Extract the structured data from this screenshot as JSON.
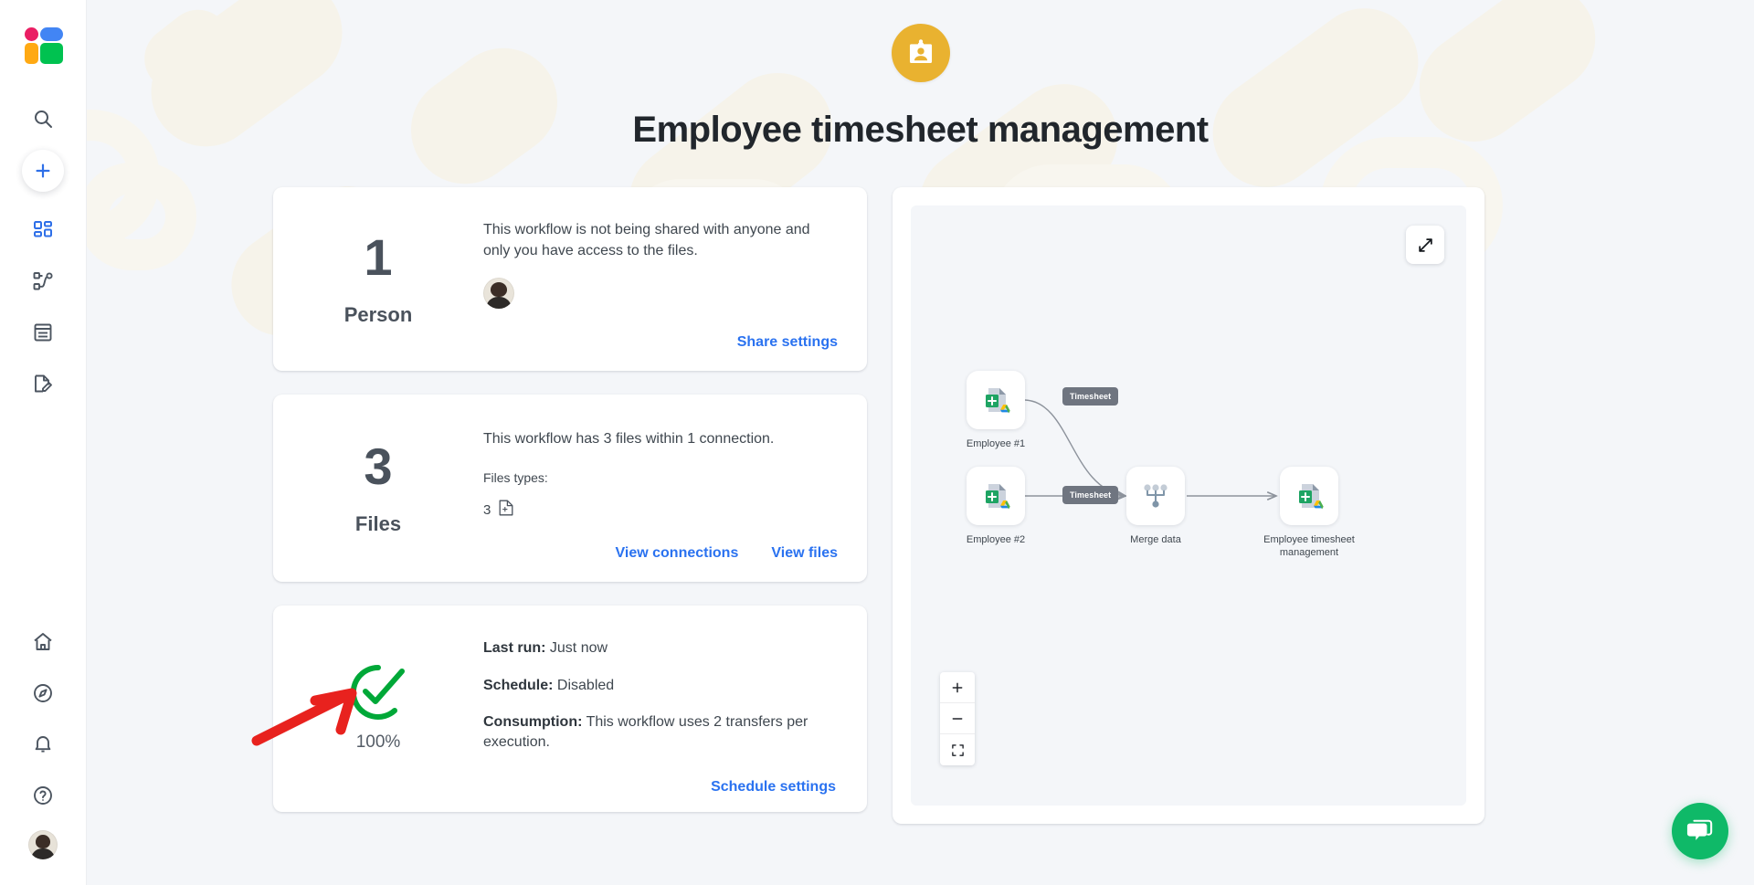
{
  "sidebar": {
    "logo_name": "app-logo",
    "items": [
      {
        "name": "search-icon",
        "label": "Search"
      },
      {
        "name": "create-button",
        "label": "Create"
      },
      {
        "name": "dashboard-icon",
        "label": "Dashboard"
      },
      {
        "name": "workflows-icon",
        "label": "Workflows"
      },
      {
        "name": "logs-icon",
        "label": "Logs"
      },
      {
        "name": "templates-icon",
        "label": "Templates"
      },
      {
        "name": "home-icon",
        "label": "Home"
      },
      {
        "name": "explore-icon",
        "label": "Explore"
      },
      {
        "name": "notifications-icon",
        "label": "Notifications"
      },
      {
        "name": "help-icon",
        "label": "Help"
      },
      {
        "name": "user-avatar",
        "label": "Account"
      }
    ]
  },
  "hero": {
    "badge_icon": "id-badge-icon",
    "title": "Employee timesheet management",
    "badge_color": "#e9b230"
  },
  "cards": {
    "person": {
      "number": "1",
      "label": "Person",
      "description": "This workflow is not being shared with anyone and only you have access to the files.",
      "avatar_name": "owner-avatar",
      "link": "Share settings"
    },
    "files": {
      "number": "3",
      "label": "Files",
      "description": "This workflow has 3 files within 1 connection.",
      "types_label": "Files types:",
      "type_count": "3",
      "type_icon": "file-icon",
      "link_connections": "View connections",
      "link_files": "View files"
    },
    "status": {
      "percent": "100%",
      "status_icon": "success-check-icon",
      "status_color": "#00a838",
      "annotation_color": "#e8221e",
      "last_run_label": "Last run:",
      "last_run_value": "Just now",
      "schedule_label": "Schedule:",
      "schedule_value": "Disabled",
      "consumption_label": "Consumption:",
      "consumption_value": "This workflow uses 2 transfers per execution.",
      "link": "Schedule settings"
    }
  },
  "diagram": {
    "expand_icon": "expand-diagonal-icon",
    "zoom_in": "+",
    "zoom_out": "−",
    "fit_icon": "fit-screen-icon",
    "nodes": [
      {
        "id": "employee1",
        "label": "Employee #1",
        "icon": "google-sheets-drive-icon"
      },
      {
        "id": "employee2",
        "label": "Employee #2",
        "icon": "google-sheets-drive-icon"
      },
      {
        "id": "merge",
        "label": "Merge data",
        "icon": "merge-nodes-icon"
      },
      {
        "id": "output",
        "label": "Employee timesheet management",
        "icon": "google-sheets-drive-icon"
      }
    ],
    "edge_labels": [
      "Timesheet",
      "Timesheet"
    ]
  },
  "chat": {
    "icon": "chat-bubbles-icon",
    "color": "#0fb968"
  }
}
